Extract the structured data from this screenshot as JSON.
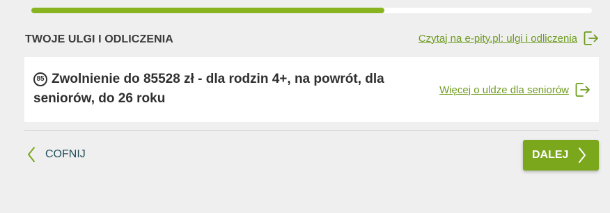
{
  "progress": {
    "percent": 63
  },
  "section": {
    "title": "TWOJE ULGI I ODLICZENIA",
    "link_label": "Czytaj na e-pity.pl: ulgi i odliczenia"
  },
  "card": {
    "badge": "85",
    "title": "Zwolnienie do 85528 zł - dla rodzin 4+, na powrót, dla seniorów, do 26 roku",
    "link_label": "Więcej o uldze dla seniorów"
  },
  "nav": {
    "back_label": "COFNIJ",
    "next_label": "DALEJ"
  },
  "colors": {
    "accent": "#7aa71c",
    "progress": "#8ab41f",
    "link": "#6e9b1e",
    "back_text": "#234f5a"
  },
  "icons": {
    "external": "external-link-icon",
    "back": "chevron-left-icon",
    "next": "chevron-right-icon"
  }
}
